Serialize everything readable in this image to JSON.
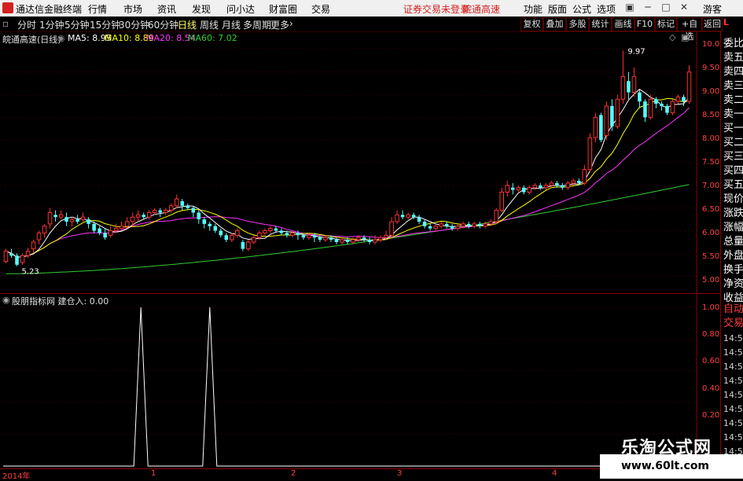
{
  "app": {
    "name": "通达信金融终端",
    "menu": [
      "行情",
      "市场",
      "资讯",
      "发现",
      "问小达",
      "财富圈",
      "交易"
    ],
    "notice_left": "证券交易未登录",
    "notice_right": "皖通高速",
    "right_menu": [
      "功能",
      "版面",
      "公式",
      "选项"
    ],
    "guest": "游客"
  },
  "toolbar": {
    "periods": [
      "分时",
      "1分钟",
      "5分钟",
      "15分钟",
      "30分钟",
      "60分钟",
      "日线",
      "周线",
      "月线",
      "多周期",
      "更多"
    ],
    "active_period": "日线",
    "right_buttons": [
      "复权",
      "叠加",
      "多股",
      "统计",
      "画线",
      "F10",
      "标记",
      "+自选",
      "返回"
    ]
  },
  "main_chart": {
    "stock_label": "皖通高速(日线)",
    "ma": [
      {
        "label": "MA5: 8.95",
        "color": "#ffffff"
      },
      {
        "label": "MA10: 8.89",
        "color": "#ffff00"
      },
      {
        "label": "MA20: 8.54",
        "color": "#ff33ff"
      },
      {
        "label": "MA60: 7.02",
        "color": "#33cc33"
      }
    ],
    "high_label": "9.97",
    "low_label": "5.23",
    "y_ticks": [
      "10.00",
      "9.50",
      "9.00",
      "8.50",
      "8.00",
      "7.50",
      "7.00",
      "6.50",
      "6.00",
      "5.50",
      "5.00"
    ]
  },
  "indicator": {
    "label": "股朋指标网  建仓入: 0.00",
    "y_ticks": [
      "1.00",
      "0.80",
      "0.60",
      "0.40",
      "0.20"
    ]
  },
  "x_axis": {
    "labels": [
      "2014年",
      "1",
      "2",
      "3",
      "4"
    ]
  },
  "right_panel": {
    "labels": [
      "委比",
      "卖五",
      "卖四",
      "卖三",
      "卖二",
      "卖一",
      "买一",
      "买二",
      "买三",
      "买四",
      "买五",
      "现价",
      "涨跌",
      "涨幅",
      "总量",
      "外盘",
      "换手",
      "净资",
      "收益"
    ],
    "red_labels": [
      "自动",
      "交易"
    ],
    "times": [
      "14:56",
      "14:56",
      "14:56",
      "14:56",
      "14:56",
      "14:56",
      "14:56",
      "14:56",
      "14:56"
    ]
  },
  "watermark": {
    "title": "乐淘公式网",
    "url": "www.60lt.com"
  },
  "chart_data": {
    "type": "candlestick",
    "y_range": [
      4.9,
      10.1
    ],
    "candles": [
      [
        5.32,
        5.55,
        5.28,
        5.6
      ],
      [
        5.5,
        5.45,
        5.4,
        5.6
      ],
      [
        5.45,
        5.25,
        5.22,
        5.5
      ],
      [
        5.3,
        5.45,
        5.25,
        5.5
      ],
      [
        5.45,
        5.55,
        5.4,
        5.62
      ],
      [
        5.6,
        5.75,
        5.5,
        5.8
      ],
      [
        5.8,
        5.95,
        5.7,
        6.0
      ],
      [
        5.95,
        6.1,
        5.85,
        6.15
      ],
      [
        6.15,
        6.4,
        6.05,
        6.5
      ],
      [
        6.35,
        6.3,
        6.2,
        6.45
      ],
      [
        6.3,
        6.35,
        6.25,
        6.45
      ],
      [
        6.3,
        6.2,
        6.1,
        6.4
      ],
      [
        6.2,
        6.25,
        6.1,
        6.3
      ],
      [
        6.25,
        6.2,
        6.15,
        6.35
      ],
      [
        6.25,
        6.3,
        6.2,
        6.4
      ],
      [
        6.25,
        6.15,
        6.05,
        6.3
      ],
      [
        6.15,
        6.0,
        5.95,
        6.2
      ],
      [
        6.05,
        5.95,
        5.9,
        6.1
      ],
      [
        5.95,
        5.85,
        5.8,
        6.05
      ],
      [
        5.9,
        6.0,
        5.85,
        6.1
      ],
      [
        6.0,
        6.05,
        5.95,
        6.15
      ],
      [
        6.05,
        6.1,
        6.0,
        6.2
      ],
      [
        6.1,
        6.2,
        6.05,
        6.3
      ],
      [
        6.2,
        6.3,
        6.1,
        6.4
      ],
      [
        6.3,
        6.35,
        6.2,
        6.45
      ],
      [
        6.35,
        6.3,
        6.25,
        6.4
      ],
      [
        6.3,
        6.4,
        6.25,
        6.45
      ],
      [
        6.4,
        6.45,
        6.35,
        6.5
      ],
      [
        6.45,
        6.4,
        6.3,
        6.5
      ],
      [
        6.4,
        6.45,
        6.35,
        6.5
      ],
      [
        6.45,
        6.55,
        6.4,
        6.6
      ],
      [
        6.55,
        6.7,
        6.5,
        6.8
      ],
      [
        6.65,
        6.55,
        6.45,
        6.7
      ],
      [
        6.55,
        6.5,
        6.45,
        6.6
      ],
      [
        6.5,
        6.4,
        6.3,
        6.55
      ],
      [
        6.4,
        6.25,
        6.15,
        6.45
      ],
      [
        6.25,
        6.15,
        6.05,
        6.3
      ],
      [
        6.15,
        6.1,
        6.0,
        6.2
      ],
      [
        6.1,
        6.0,
        5.95,
        6.15
      ],
      [
        6.0,
        5.9,
        5.85,
        6.05
      ],
      [
        5.9,
        5.8,
        5.75,
        5.95
      ],
      [
        5.8,
        5.9,
        5.75,
        5.95
      ],
      [
        5.9,
        6.0,
        5.85,
        6.05
      ],
      [
        5.75,
        5.6,
        5.55,
        5.8
      ],
      [
        5.6,
        5.75,
        5.55,
        5.8
      ],
      [
        5.75,
        5.85,
        5.7,
        5.9
      ],
      [
        5.85,
        5.95,
        5.8,
        6.0
      ],
      [
        5.95,
        6.0,
        5.9,
        6.05
      ],
      [
        6.0,
        6.05,
        5.95,
        6.1
      ],
      [
        6.05,
        6.0,
        5.95,
        6.1
      ],
      [
        6.0,
        5.95,
        5.9,
        6.05
      ],
      [
        5.95,
        5.9,
        5.85,
        6.0
      ],
      [
        5.9,
        5.95,
        5.85,
        6.0
      ],
      [
        5.95,
        5.9,
        5.8,
        6.0
      ],
      [
        5.9,
        5.85,
        5.8,
        5.95
      ],
      [
        5.85,
        5.9,
        5.8,
        5.95
      ],
      [
        5.9,
        5.85,
        5.75,
        5.95
      ],
      [
        5.85,
        5.8,
        5.75,
        5.9
      ],
      [
        5.8,
        5.85,
        5.75,
        5.9
      ],
      [
        5.85,
        5.8,
        5.75,
        5.9
      ],
      [
        5.8,
        5.75,
        5.7,
        5.85
      ],
      [
        5.75,
        5.8,
        5.7,
        5.85
      ],
      [
        5.8,
        5.75,
        5.7,
        5.85
      ],
      [
        5.75,
        5.8,
        5.7,
        5.85
      ],
      [
        5.8,
        5.85,
        5.75,
        5.9
      ],
      [
        5.85,
        5.8,
        5.75,
        5.9
      ],
      [
        5.8,
        5.75,
        5.7,
        5.85
      ],
      [
        5.75,
        5.8,
        5.7,
        5.9
      ],
      [
        5.8,
        5.85,
        5.75,
        5.9
      ],
      [
        5.85,
        5.9,
        5.8,
        6.0
      ],
      [
        5.9,
        6.2,
        5.85,
        6.3
      ],
      [
        6.2,
        6.35,
        6.15,
        6.45
      ],
      [
        6.35,
        6.3,
        6.25,
        6.45
      ],
      [
        6.3,
        6.35,
        6.25,
        6.4
      ],
      [
        6.35,
        6.3,
        6.25,
        6.4
      ],
      [
        6.3,
        6.2,
        6.15,
        6.35
      ],
      [
        6.2,
        6.1,
        6.05,
        6.25
      ],
      [
        6.1,
        6.05,
        6.0,
        6.15
      ],
      [
        6.05,
        6.1,
        6.0,
        6.15
      ],
      [
        6.1,
        6.15,
        6.05,
        6.2
      ],
      [
        6.15,
        6.1,
        6.05,
        6.2
      ],
      [
        6.1,
        6.05,
        6.0,
        6.15
      ],
      [
        6.05,
        6.1,
        6.0,
        6.15
      ],
      [
        6.1,
        6.15,
        6.05,
        6.2
      ],
      [
        6.15,
        6.1,
        6.05,
        6.2
      ],
      [
        6.1,
        6.15,
        6.05,
        6.2
      ],
      [
        6.15,
        6.1,
        6.05,
        6.2
      ],
      [
        6.1,
        6.15,
        6.05,
        6.2
      ],
      [
        6.15,
        6.2,
        6.1,
        6.25
      ],
      [
        6.2,
        6.45,
        6.15,
        6.5
      ],
      [
        6.45,
        6.85,
        6.4,
        6.95
      ],
      [
        6.85,
        7.0,
        6.75,
        7.1
      ],
      [
        6.95,
        6.9,
        6.8,
        7.05
      ],
      [
        6.9,
        6.95,
        6.85,
        7.0
      ],
      [
        6.95,
        6.85,
        6.8,
        7.0
      ],
      [
        6.85,
        6.95,
        6.8,
        7.0
      ],
      [
        6.95,
        7.0,
        6.9,
        7.05
      ],
      [
        7.0,
        6.95,
        6.9,
        7.05
      ],
      [
        6.95,
        7.0,
        6.9,
        7.05
      ],
      [
        7.0,
        7.05,
        6.95,
        7.1
      ],
      [
        7.05,
        7.0,
        6.95,
        7.1
      ],
      [
        7.0,
        6.95,
        6.9,
        7.05
      ],
      [
        6.95,
        7.05,
        6.9,
        7.1
      ],
      [
        7.05,
        7.1,
        7.0,
        7.15
      ],
      [
        7.1,
        7.05,
        7.0,
        7.15
      ],
      [
        7.05,
        7.35,
        7.0,
        7.45
      ],
      [
        7.35,
        8.05,
        7.3,
        8.15
      ],
      [
        8.05,
        8.5,
        7.95,
        8.6
      ],
      [
        8.55,
        8.0,
        7.95,
        8.6
      ],
      [
        8.1,
        8.75,
        8.0,
        8.85
      ],
      [
        8.75,
        8.3,
        8.2,
        8.9
      ],
      [
        8.3,
        8.9,
        8.25,
        9.0
      ],
      [
        8.9,
        9.4,
        8.8,
        9.97
      ],
      [
        9.3,
        9.05,
        8.9,
        9.5
      ],
      [
        9.05,
        9.4,
        8.95,
        9.6
      ],
      [
        9.05,
        8.85,
        8.7,
        9.1
      ],
      [
        8.85,
        8.5,
        8.4,
        8.9
      ],
      [
        8.5,
        8.9,
        8.45,
        9.0
      ],
      [
        8.9,
        8.8,
        8.7,
        8.95
      ],
      [
        8.8,
        8.75,
        8.65,
        8.85
      ],
      [
        8.75,
        8.6,
        8.55,
        8.8
      ],
      [
        8.6,
        8.85,
        8.55,
        8.9
      ],
      [
        8.85,
        8.95,
        8.8,
        9.0
      ],
      [
        8.95,
        8.85,
        8.75,
        9.0
      ],
      [
        8.85,
        9.5,
        8.8,
        9.65
      ]
    ],
    "ma5_last": 8.95,
    "ma10_last": 8.89,
    "ma20_last": 8.54,
    "ma60_last": 7.02,
    "indicator_spikes": [
      0.2,
      0.3
    ],
    "indicator_range": [
      0,
      1
    ]
  }
}
